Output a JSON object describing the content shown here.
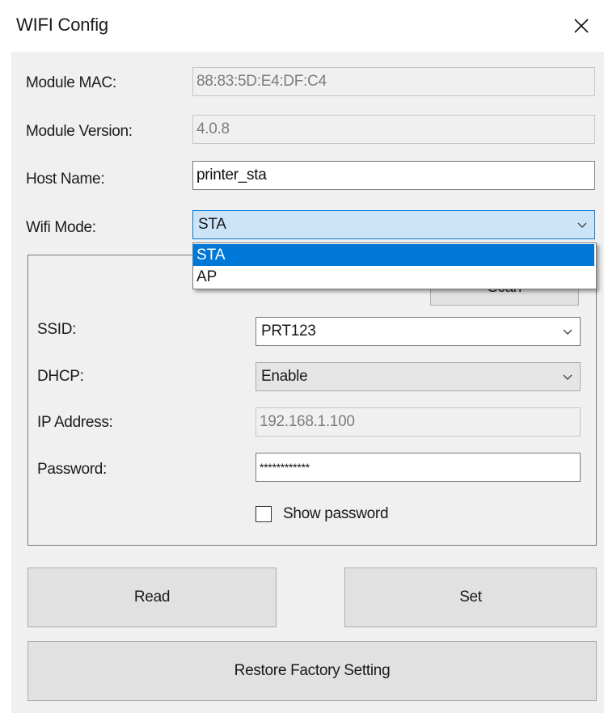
{
  "window": {
    "title": "WIFI Config"
  },
  "form": {
    "module_mac_label": "Module MAC:",
    "module_mac_value": "88:83:5D:E4:DF:C4",
    "module_version_label": "Module Version:",
    "module_version_value": "4.0.8",
    "host_name_label": "Host Name:",
    "host_name_value": "printer_sta",
    "wifi_mode_label": "Wifi Mode:",
    "wifi_mode_value": "STA",
    "wifi_mode_options": [
      "STA",
      "AP"
    ]
  },
  "group": {
    "scan_button_label": "Scan",
    "ssid_label": "SSID:",
    "ssid_value": "PRT123",
    "dhcp_label": "DHCP:",
    "dhcp_value": "Enable",
    "ip_address_label": "IP Address:",
    "ip_address_value": "192.168.1.100",
    "password_label": "Password:",
    "password_value": "************",
    "show_password_label": "Show password",
    "show_password_checked": false
  },
  "actions": {
    "read_label": "Read",
    "set_label": "Set",
    "restore_label": "Restore Factory Setting"
  },
  "colors": {
    "accent": "#0078d7",
    "focus_fill": "#cce4f7",
    "client_bg": "#f0f0f0"
  }
}
